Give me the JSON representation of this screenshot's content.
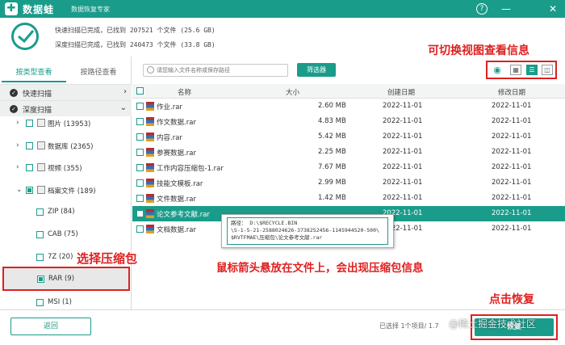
{
  "app": {
    "name": "数据蛙",
    "subtitle": "数据恢复专家",
    "help_icon": "?",
    "minimize_icon": "—",
    "close_icon": "✕"
  },
  "summary": {
    "quick_scan": "快速扫描已完成，已找到 207521 个文件 (25.6 GB)",
    "deep_scan": "深度扫描已完成，已找到 240473 个文件 (33.8 GB)"
  },
  "left": {
    "tabs": [
      "按类型查看",
      "按路径查看"
    ],
    "scan_rows": [
      "快速扫描",
      "深度扫描"
    ],
    "tree": [
      {
        "label": "图片 (13953)"
      },
      {
        "label": "数据库 (2365)"
      },
      {
        "label": "视频 (355)"
      },
      {
        "label": "档案文件 (189)"
      },
      {
        "label": "ZIP (84)"
      },
      {
        "label": "CAB (75)"
      },
      {
        "label": "7Z (20)"
      },
      {
        "label": "RAR (9)"
      },
      {
        "label": "MSI (1)"
      }
    ]
  },
  "toolbar": {
    "search_placeholder": "请您输入文件名称或保存路径",
    "filter_label": "筛选器"
  },
  "table": {
    "headers": [
      "名称",
      "大小",
      "创建日期",
      "修改日期"
    ],
    "rows": [
      {
        "name": "作业.rar",
        "size": "2.60 MB",
        "created": "2022-11-01",
        "modified": "2022-11-01"
      },
      {
        "name": "作文数据.rar",
        "size": "4.83 MB",
        "created": "2022-11-01",
        "modified": "2022-11-01"
      },
      {
        "name": "内容.rar",
        "size": "5.42 MB",
        "created": "2022-11-01",
        "modified": "2022-11-01"
      },
      {
        "name": "参赛数据.rar",
        "size": "2.25 MB",
        "created": "2022-11-01",
        "modified": "2022-11-01"
      },
      {
        "name": "工作内容压缩包-1.rar",
        "size": "7.67 MB",
        "created": "2022-11-01",
        "modified": "2022-11-01"
      },
      {
        "name": "技能文模板.rar",
        "size": "2.99 MB",
        "created": "2022-11-01",
        "modified": "2022-11-01"
      },
      {
        "name": "文件数据.rar",
        "size": "1.42 MB",
        "created": "2022-11-01",
        "modified": "2022-11-01"
      },
      {
        "name": "论文参考文献.rar",
        "size": "",
        "created": "2022-11-01",
        "modified": "2022-11-01"
      },
      {
        "name": "文档数据.rar",
        "size": "",
        "created": "2022-11-01",
        "modified": "2022-11-01"
      }
    ]
  },
  "tooltip": {
    "line1": "路径： D:\\$RECYCLE.BIN",
    "line2": "\\S-1-5-21-2588024626-3738252456-1145944520-500\\",
    "line3": "$RVTFMAE\\压缩包\\论文参考文献.rar"
  },
  "annotations": {
    "view_switch": "可切换视图查看信息",
    "select_archive": "选择压缩包",
    "hover_info": "鼠标箭头悬放在文件上，会出现压缩包信息",
    "click_recover": "点击恢复"
  },
  "bottom": {
    "back_label": "返回",
    "status": "已选择 1个项目/ 1.7",
    "recover_label": "恢复",
    "watermark": "@稀土掘金技术社区"
  },
  "colors": {
    "accent": "#1a9c8b",
    "annotation": "#e02020"
  }
}
